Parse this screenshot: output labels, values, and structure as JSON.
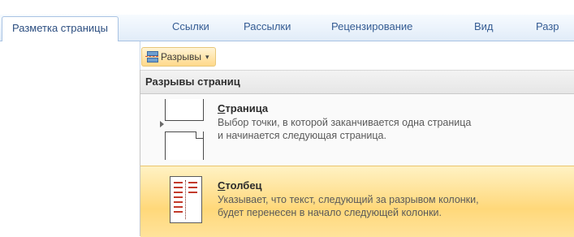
{
  "ribbon": {
    "tabs": [
      {
        "label": "Разметка страницы",
        "active": true
      },
      {
        "label": "Ссылки",
        "active": false
      },
      {
        "label": "Рассылки",
        "active": false
      },
      {
        "label": "Рецензирование",
        "active": false
      },
      {
        "label": "Вид",
        "active": false
      },
      {
        "label": "Разр",
        "active": false
      }
    ]
  },
  "breaks_button": {
    "label": "Разрывы",
    "icon": "page-breaks-icon",
    "caret": "▾"
  },
  "menu": {
    "header": "Разрывы страниц",
    "items": [
      {
        "title_accel": "С",
        "title_rest": "траница",
        "desc_line1": "Выбор точки, в которой заканчивается одна страница",
        "desc_line2": "и начинается следующая страница.",
        "icon": "page-break-icon",
        "highlighted": false
      },
      {
        "title_accel": "С",
        "title_rest": "толбец",
        "desc_line1": "Указывает, что текст, следующий за разрывом колонки,",
        "desc_line2": "будет перенесен в начало следующей колонки.",
        "icon": "column-break-icon",
        "highlighted": true
      }
    ]
  },
  "colors": {
    "ribbon_text": "#355c93",
    "highlight": "#ffd87a",
    "break_line": "#c23a2b"
  }
}
